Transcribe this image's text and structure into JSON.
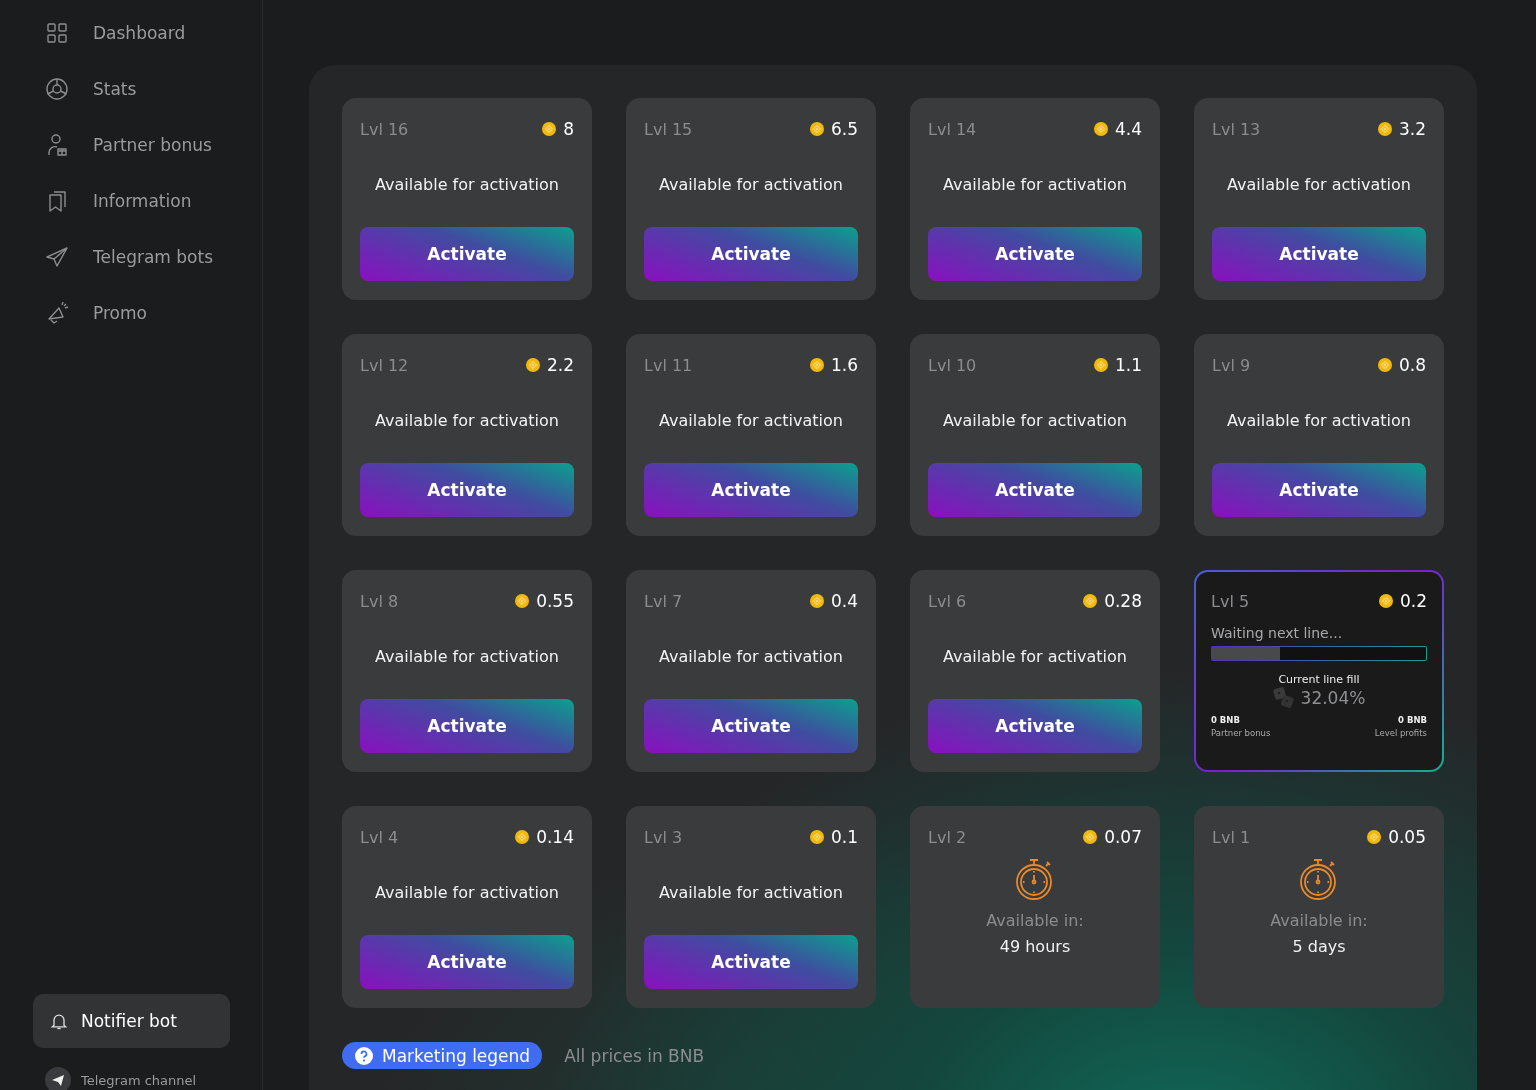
{
  "sidebar": {
    "items": [
      {
        "label": "Dashboard"
      },
      {
        "label": "Stats"
      },
      {
        "label": "Partner bonus"
      },
      {
        "label": "Information"
      },
      {
        "label": "Telegram bots"
      },
      {
        "label": "Promo"
      }
    ],
    "notifier_button": "Notifier bot",
    "channel_link": "Telegram channel"
  },
  "levels": [
    {
      "kind": "available",
      "level_label": "Lvl 16",
      "price": "8",
      "status": "Available for activation",
      "button": "Activate"
    },
    {
      "kind": "available",
      "level_label": "Lvl 15",
      "price": "6.5",
      "status": "Available for activation",
      "button": "Activate"
    },
    {
      "kind": "available",
      "level_label": "Lvl 14",
      "price": "4.4",
      "status": "Available for activation",
      "button": "Activate"
    },
    {
      "kind": "available",
      "level_label": "Lvl 13",
      "price": "3.2",
      "status": "Available for activation",
      "button": "Activate"
    },
    {
      "kind": "available",
      "level_label": "Lvl 12",
      "price": "2.2",
      "status": "Available for activation",
      "button": "Activate"
    },
    {
      "kind": "available",
      "level_label": "Lvl 11",
      "price": "1.6",
      "status": "Available for activation",
      "button": "Activate"
    },
    {
      "kind": "available",
      "level_label": "Lvl 10",
      "price": "1.1",
      "status": "Available for activation",
      "button": "Activate"
    },
    {
      "kind": "available",
      "level_label": "Lvl 9",
      "price": "0.8",
      "status": "Available for activation",
      "button": "Activate"
    },
    {
      "kind": "available",
      "level_label": "Lvl 8",
      "price": "0.55",
      "status": "Available for activation",
      "button": "Activate"
    },
    {
      "kind": "available",
      "level_label": "Lvl 7",
      "price": "0.4",
      "status": "Available for activation",
      "button": "Activate"
    },
    {
      "kind": "available",
      "level_label": "Lvl 6",
      "price": "0.28",
      "status": "Available for activation",
      "button": "Activate"
    },
    {
      "kind": "waiting",
      "level_label": "Lvl 5",
      "price": "0.2",
      "status": "Waiting next line...",
      "level": 0.32,
      "fill_label": "Current line fill",
      "fill_value": "32.04%",
      "partner_value": "0 BNB",
      "partner_label": "Partner bonus",
      "profit_value": "0 BNB",
      "profit_label": "Level profits"
    },
    {
      "kind": "available",
      "level_label": "Lvl 4",
      "price": "0.14",
      "status": "Available for activation",
      "button": "Activate"
    },
    {
      "kind": "available",
      "level_label": "Lvl 3",
      "price": "0.1",
      "status": "Available for activation",
      "button": "Activate"
    },
    {
      "kind": "locked",
      "level_label": "Lvl 2",
      "price": "0.07",
      "status": "Available in:",
      "time": "49 hours"
    },
    {
      "kind": "locked",
      "level_label": "Lvl 1",
      "price": "0.05",
      "status": "Available in:",
      "time": "5 days"
    }
  ],
  "footer": {
    "legend_button": "Marketing legend",
    "note": "All prices in BNB"
  }
}
